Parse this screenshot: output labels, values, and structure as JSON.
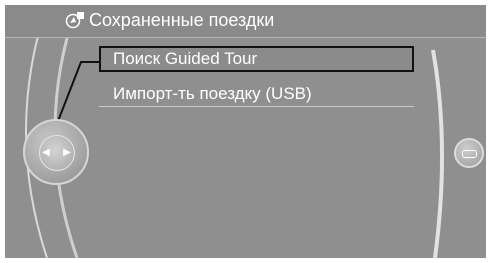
{
  "header": {
    "title": "Сохраненные поездки",
    "icon": "saved-trips-icon"
  },
  "menu": {
    "items": [
      {
        "label": "Поиск Guided Tour",
        "selected": true
      },
      {
        "label": "Импорт-ть поездку (USB)",
        "selected": false
      }
    ]
  },
  "controller": {
    "icon": "controller-knob-icon",
    "left_arrow": "◀",
    "right_arrow": "▶"
  },
  "side_button": {
    "icon": "option-button-icon"
  },
  "colors": {
    "screen_bg": "#8f8f8f",
    "text": "#ffffff",
    "selection_border": "#111111",
    "arc": "#d4d4d4"
  }
}
